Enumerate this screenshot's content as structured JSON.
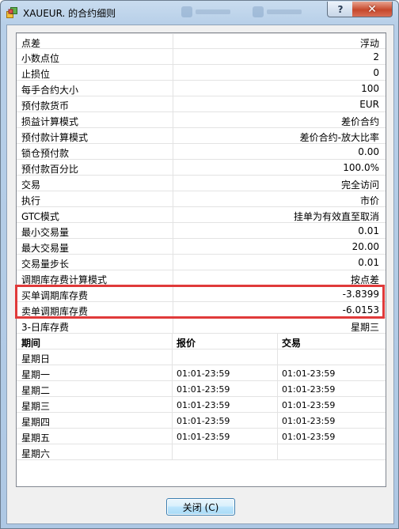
{
  "window": {
    "title": "XAUEUR. 的合约细则",
    "help_glyph": "?",
    "close_glyph": "✕"
  },
  "properties": [
    {
      "key": "点差",
      "value": "浮动"
    },
    {
      "key": "小数点位",
      "value": "2"
    },
    {
      "key": "止损位",
      "value": "0"
    },
    {
      "key": "每手合约大小",
      "value": "100"
    },
    {
      "key": "预付款货币",
      "value": "EUR"
    },
    {
      "key": "损益计算模式",
      "value": "差价合约"
    },
    {
      "key": "预付款计算模式",
      "value": "差价合约-放大比率"
    },
    {
      "key": "锁仓预付款",
      "value": "0.00"
    },
    {
      "key": "预付款百分比",
      "value": "100.0%"
    },
    {
      "key": "交易",
      "value": "完全访问"
    },
    {
      "key": "执行",
      "value": "市价"
    },
    {
      "key": "GTC模式",
      "value": "挂单为有效直至取消"
    },
    {
      "key": "最小交易量",
      "value": "0.01"
    },
    {
      "key": "最大交易量",
      "value": "20.00"
    },
    {
      "key": "交易量步长",
      "value": "0.01"
    },
    {
      "key": "调期库存费计算模式",
      "value": "按点差"
    },
    {
      "key": "买单调期库存费",
      "value": "-3.8399"
    },
    {
      "key": "卖单调期库存费",
      "value": "-6.0153"
    },
    {
      "key": "3-日库存费",
      "value": "星期三"
    }
  ],
  "schedule": {
    "headers": {
      "period": "期间",
      "quote": "报价",
      "trade": "交易"
    },
    "rows": [
      {
        "day": "星期日",
        "quote": "",
        "trade": ""
      },
      {
        "day": "星期一",
        "quote": "01:01-23:59",
        "trade": "01:01-23:59"
      },
      {
        "day": "星期二",
        "quote": "01:01-23:59",
        "trade": "01:01-23:59"
      },
      {
        "day": "星期三",
        "quote": "01:01-23:59",
        "trade": "01:01-23:59"
      },
      {
        "day": "星期四",
        "quote": "01:01-23:59",
        "trade": "01:01-23:59"
      },
      {
        "day": "星期五",
        "quote": "01:01-23:59",
        "trade": "01:01-23:59"
      },
      {
        "day": "星期六",
        "quote": "",
        "trade": ""
      }
    ]
  },
  "footer": {
    "close_label": "关闭 (C)"
  },
  "colors": {
    "highlight": "#e03a3a",
    "accent": "#3c7fb1"
  }
}
